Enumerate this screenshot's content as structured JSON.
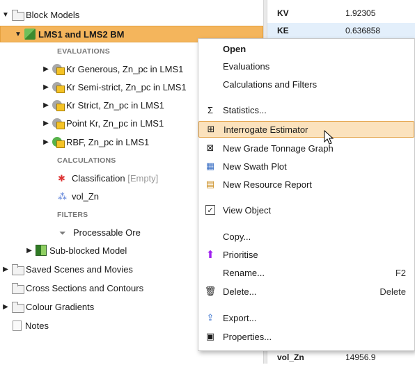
{
  "tree": {
    "block_models": "Block Models",
    "selected_model": "LMS1 and LMS2 BM",
    "section_evaluations": "EVALUATIONS",
    "evaluations": [
      "Kr Generous, Zn_pc in LMS1",
      "Kr Semi-strict, Zn_pc in LMS1",
      "Kr Strict, Zn_pc in LMS1",
      "Point Kr, Zn_pc in LMS1",
      "RBF, Zn_pc in LMS1"
    ],
    "section_calculations": "CALCULATIONS",
    "classification": "Classification",
    "classification_note": "[Empty]",
    "vol_zn": "vol_Zn",
    "section_filters": "FILTERS",
    "processable_ore": "Processable Ore",
    "sub_blocked": "Sub-blocked Model",
    "saved_scenes": "Saved Scenes and Movies",
    "cross_sections": "Cross Sections and Contours",
    "colour_gradients": "Colour Gradients",
    "notes": "Notes"
  },
  "props": {
    "rows": [
      {
        "key": "KV",
        "value": "1.92305"
      },
      {
        "key": "KE",
        "value": "0.636858"
      },
      {
        "key": "vol_Zn",
        "value": "14956.9"
      }
    ]
  },
  "menu": {
    "open": "Open",
    "evaluations": "Evaluations",
    "calculations": "Calculations and Filters",
    "statistics": "Statistics...",
    "interrogate": "Interrogate Estimator",
    "grade_tonnage": "New Grade Tonnage Graph",
    "swath": "New Swath Plot",
    "resource_report": "New Resource Report",
    "view_object": "View Object",
    "copy": "Copy...",
    "prioritise": "Prioritise",
    "rename": "Rename...",
    "rename_shortcut": "F2",
    "delete": "Delete...",
    "delete_shortcut": "Delete",
    "export": "Export...",
    "properties": "Properties..."
  },
  "colors": {
    "selection": "#f4b55c",
    "menu_highlight": "#fbe2bd",
    "accent_purple": "#a020f0"
  }
}
